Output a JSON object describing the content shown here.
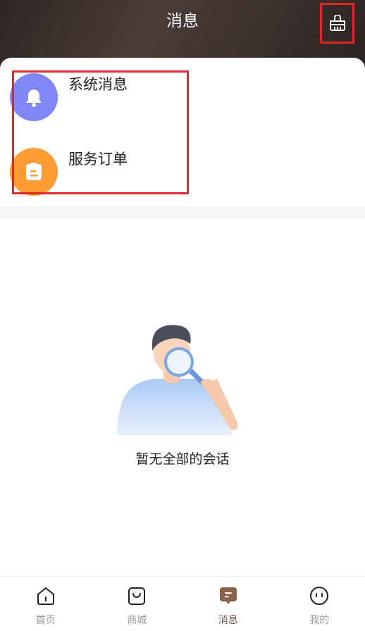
{
  "header": {
    "title": "消息",
    "clean_icon": "broom-clean-icon"
  },
  "entries": [
    {
      "label": "系统消息",
      "icon": "bell-icon",
      "color": "#7f86f5"
    },
    {
      "label": "服务订单",
      "icon": "clipboard-icon",
      "color": "#ff9b33"
    }
  ],
  "empty_state": {
    "text": "暂无全部的会话",
    "illustration": "man-with-magnifier-illustration"
  },
  "tabbar": {
    "items": [
      {
        "label": "首页",
        "icon": "home-icon",
        "active": false
      },
      {
        "label": "商城",
        "icon": "shopping-bag-icon",
        "active": false
      },
      {
        "label": "消息",
        "icon": "message-icon",
        "active": true
      },
      {
        "label": "我的",
        "icon": "profile-face-icon",
        "active": false
      }
    ]
  },
  "colors": {
    "header_bg": "#3a302c",
    "accent": "#7a5a44",
    "highlight": "#e0282c"
  }
}
